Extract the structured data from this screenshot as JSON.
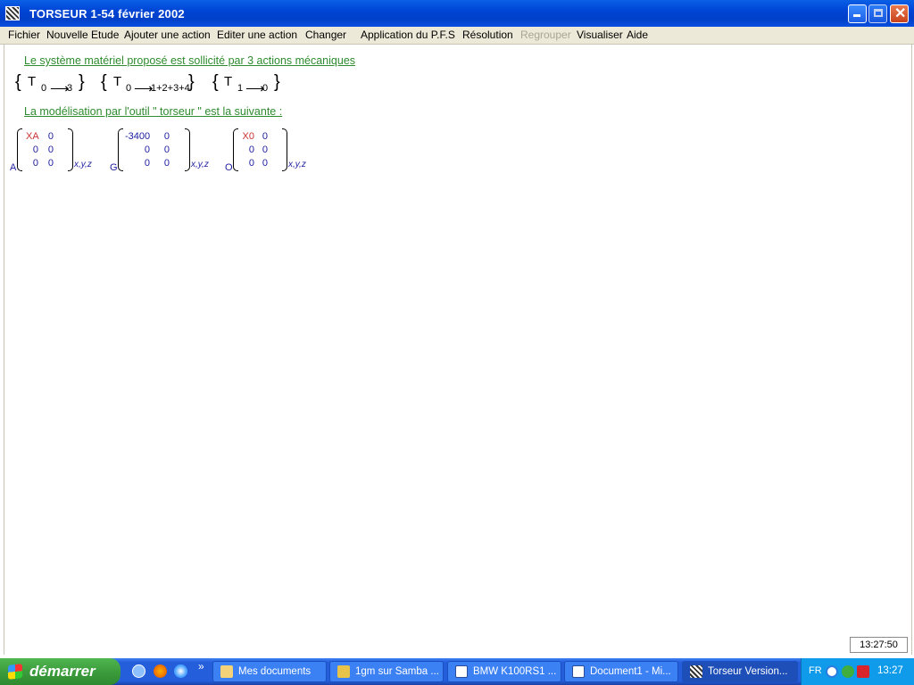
{
  "window": {
    "title": "TORSEUR 1-54  février 2002"
  },
  "menu": [
    "Fichier",
    "Nouvelle Etude",
    "Ajouter une action",
    "Editer une action",
    "Changer",
    "Application du P.F.S",
    "Résolution",
    "Regrouper",
    "Visualiser",
    "Aide"
  ],
  "menu_disabled": "Regrouper",
  "content": {
    "heading1": "Le système matériel proposé est sollicité par 3 actions mécaniques",
    "heading2": "La modélisation par l'outil \" torseur \" est la suivante :",
    "torsors": [
      {
        "symbol": "T",
        "from": "0",
        "arrow": "⟶",
        "to": "3"
      },
      {
        "symbol": "T",
        "from": "0",
        "arrow": "⟶",
        "to": "1+2+3+4"
      },
      {
        "symbol": "T",
        "from": "1",
        "arrow": "⟶",
        "to": "0"
      }
    ],
    "matrices": [
      {
        "point": "A",
        "cells": [
          [
            "XA",
            "0"
          ],
          [
            "0",
            "0"
          ],
          [
            "0",
            "0"
          ]
        ],
        "basis": "x,y,z"
      },
      {
        "point": "G",
        "cells": [
          [
            "-3400",
            "0"
          ],
          [
            "0",
            "0"
          ],
          [
            "0",
            "0"
          ]
        ],
        "basis": "x,y,z"
      },
      {
        "point": "O",
        "cells": [
          [
            "X0",
            "0"
          ],
          [
            "0",
            "0"
          ],
          [
            "0",
            "0"
          ]
        ],
        "basis": "x,y,z"
      }
    ]
  },
  "status_clock": "13:27:50",
  "taskbar": {
    "start_label": "démarrer",
    "quicklaunch_more": "»",
    "tasks": [
      {
        "label": "Mes documents",
        "active": false
      },
      {
        "label": "1gm sur Samba ...",
        "active": false
      },
      {
        "label": "BMW K100RS1 ...",
        "active": false
      },
      {
        "label": "Document1 - Mi...",
        "active": false
      },
      {
        "label": "Torseur Version...",
        "active": true
      }
    ],
    "tray": {
      "language": "FR",
      "clock": "13:27"
    }
  },
  "colors": {
    "heading": "#2e8b2e",
    "values": "#1c1ca0",
    "unknowns": "#c83232",
    "titlebar": "#0045d6"
  }
}
